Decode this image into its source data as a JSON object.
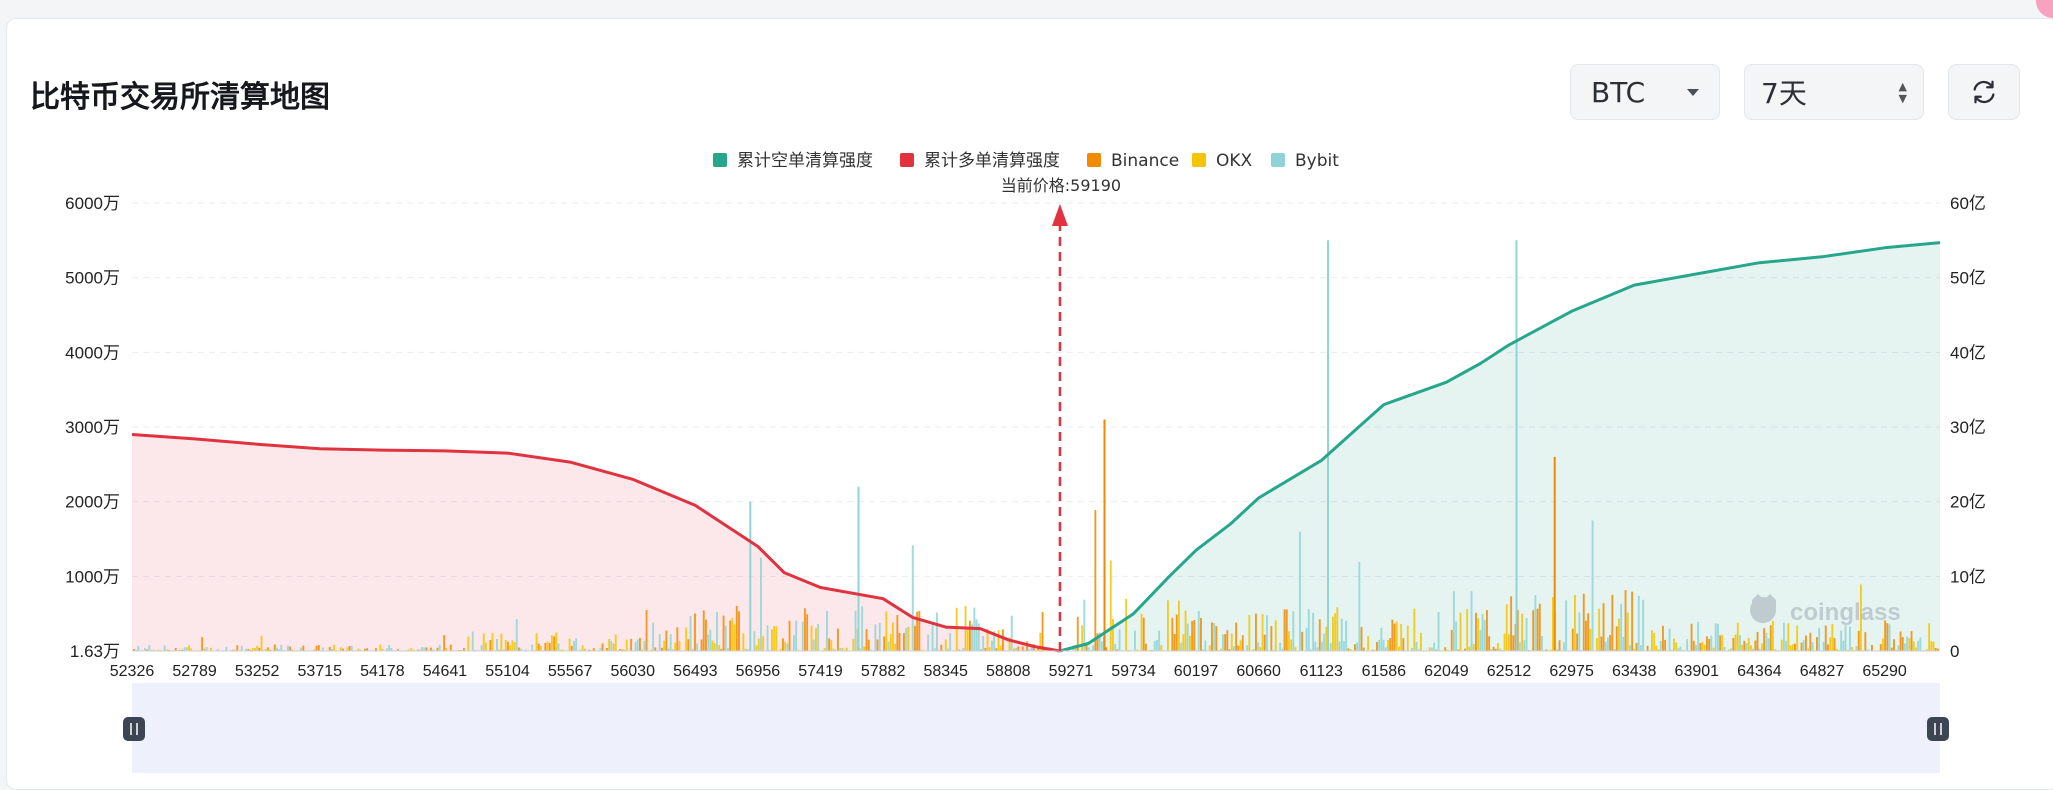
{
  "header": {
    "title": "比特币交易所清算地图",
    "coin_select": {
      "value": "BTC"
    },
    "period_select": {
      "value": "7天"
    },
    "refresh_icon": "refresh-icon"
  },
  "colors": {
    "short_cumulative": "#26a68b",
    "long_cumulative": "#e0323f",
    "binance": "#f08a00",
    "okx": "#f5c400",
    "bybit": "#8fd4d6"
  },
  "chart_data": {
    "type": "bar+line",
    "legend": [
      "累计空单清算强度",
      "累计多单清算强度",
      "Binance",
      "OKX",
      "Bybit"
    ],
    "legend_position": "top-center",
    "current_price_label": "当前价格:59190",
    "current_price": 59190,
    "x_ticks": [
      52326,
      52789,
      53252,
      53715,
      54178,
      54641,
      55104,
      55567,
      56030,
      56493,
      56956,
      57419,
      57882,
      58345,
      58808,
      59271,
      59734,
      60197,
      60660,
      61123,
      61586,
      62049,
      62512,
      62975,
      63438,
      63901,
      64364,
      64827,
      65290
    ],
    "x_range": [
      52326,
      65700
    ],
    "y_left": {
      "ticks": [
        "1.63万",
        "1000万",
        "2000万",
        "3000万",
        "4000万",
        "5000万",
        "6000万"
      ],
      "range": [
        0,
        60000000
      ]
    },
    "y_right": {
      "ticks": [
        "0",
        "10亿",
        "20亿",
        "30亿",
        "40亿",
        "50亿",
        "60亿"
      ],
      "range": [
        0,
        6000000000
      ]
    },
    "grid": true,
    "series": [
      {
        "name": "累计多单清算强度",
        "unit": "亿",
        "x": [
          52326,
          52789,
          53252,
          53715,
          54178,
          54641,
          55104,
          55567,
          56030,
          56493,
          56956,
          57150,
          57419,
          57882,
          58100,
          58345,
          58600,
          58808,
          59000,
          59190
        ],
        "y": [
          29,
          28.4,
          27.7,
          27.1,
          26.9,
          26.8,
          26.5,
          25.3,
          23,
          19.5,
          14,
          10.5,
          8.5,
          7,
          4.5,
          3.2,
          3,
          1.5,
          0.6,
          0
        ]
      },
      {
        "name": "累计空单清算强度",
        "unit": "亿",
        "x": [
          59190,
          59400,
          59734,
          60000,
          60197,
          60450,
          60660,
          61123,
          61400,
          61586,
          62049,
          62300,
          62512,
          62975,
          63438,
          63901,
          64364,
          64827,
          65290,
          65700
        ],
        "y": [
          0,
          1,
          5,
          10,
          13.5,
          17,
          20.5,
          25.5,
          30,
          33,
          36,
          38.5,
          41,
          45.5,
          49,
          50.5,
          52,
          52.8,
          54,
          54.7
        ]
      }
    ],
    "bar_spikes_note": "",
    "bar_peaks": [
      {
        "x": 56900,
        "value_wan": 2000
      },
      {
        "x": 57700,
        "value_wan": 2200
      },
      {
        "x": 59520,
        "value_wan": 3100
      },
      {
        "x": 61173,
        "value_wan": 5500
      },
      {
        "x": 62567,
        "value_wan": 5500
      },
      {
        "x": 62850,
        "value_wan": 2600
      }
    ]
  },
  "watermark": "coinglass",
  "zoom_slider": {
    "start": 0,
    "end": 100
  }
}
